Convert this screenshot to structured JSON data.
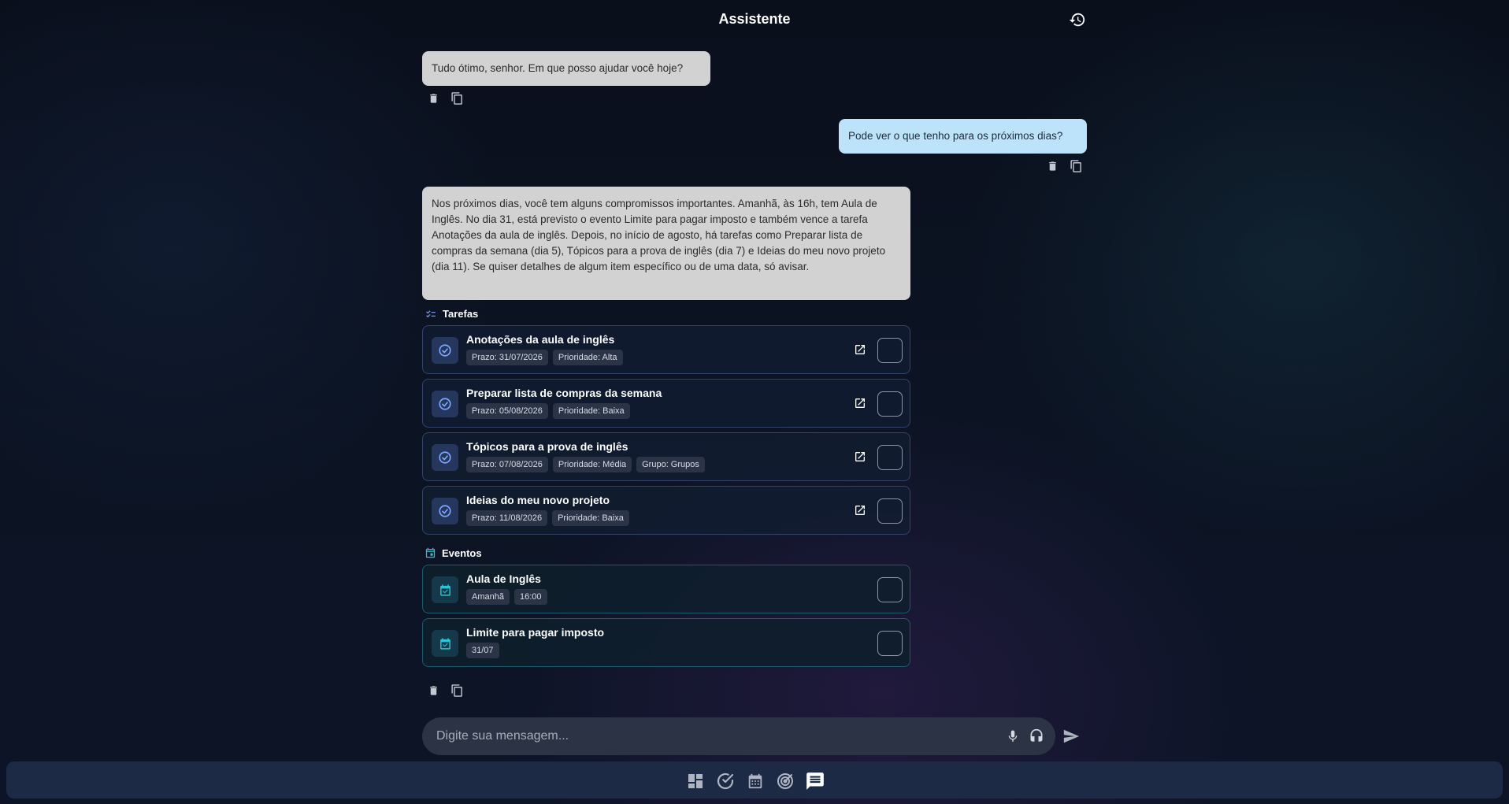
{
  "header": {
    "title": "Assistente"
  },
  "messages": [
    {
      "role": "assistant",
      "text": "Tudo ótimo, senhor. Em que posso ajudar você hoje?"
    },
    {
      "role": "user",
      "text": "Pode ver o que tenho para os próximos dias?"
    },
    {
      "role": "assistant",
      "text": "Nos próximos dias, você tem alguns compromissos importantes. Amanhã, às 16h, tem Aula de Inglês. No dia 31, está previsto o evento Limite para pagar imposto e também vence a tarefa Anotações da aula de inglês. Depois, no início de agosto, há tarefas como Preparar lista de compras da semana (dia 5), Tópicos para a prova de inglês (dia 7) e Ideias do meu novo projeto (dia 11). Se quiser detalhes de algum item específico ou de uma data, só avisar."
    }
  ],
  "tasks_section": {
    "title": "Tarefas",
    "items": [
      {
        "title": "Anotações da aula de inglês",
        "chips": [
          "Prazo: 31/07/2026",
          "Prioridade: Alta"
        ]
      },
      {
        "title": "Preparar lista de compras da semana",
        "chips": [
          "Prazo: 05/08/2026",
          "Prioridade: Baixa"
        ]
      },
      {
        "title": "Tópicos para a prova de inglês",
        "chips": [
          "Prazo: 07/08/2026",
          "Prioridade: Média",
          "Grupo: Grupos"
        ]
      },
      {
        "title": "Ideias do meu novo projeto",
        "chips": [
          "Prazo: 11/08/2026",
          "Prioridade: Baixa"
        ]
      }
    ]
  },
  "events_section": {
    "title": "Eventos",
    "items": [
      {
        "title": "Aula de Inglês",
        "chips": [
          "Amanhã",
          "16:00"
        ]
      },
      {
        "title": "Limite para pagar imposto",
        "chips": [
          "31/07"
        ]
      }
    ]
  },
  "composer": {
    "placeholder": "Digite sua mensagem..."
  },
  "colors": {
    "assistant_bubble": "#d2d2d2",
    "user_bubble": "#bde3fb",
    "task_accent": "#7fa7ff",
    "event_accent": "#2bc4d8",
    "nav_bar": "#1d2a46"
  },
  "icons": {
    "history": "history-icon",
    "delete": "trash-icon",
    "copy": "copy-icon",
    "task": "check-circle-icon",
    "event": "calendar-check-icon",
    "open": "open-external-icon",
    "mic": "microphone-icon",
    "headset": "headset-icon",
    "send": "send-icon",
    "nav": [
      "dashboard-icon",
      "check-circle-icon",
      "calendar-icon",
      "target-icon",
      "chat-icon"
    ]
  }
}
